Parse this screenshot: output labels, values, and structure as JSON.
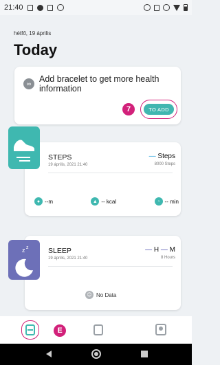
{
  "status_bar": {
    "time": "21:40"
  },
  "header": {
    "date": "hétfő, 19 április",
    "title": "Today"
  },
  "bracelet_card": {
    "message": "Add bracelet to get more health information",
    "button_label": "TO ADD",
    "callout": "7"
  },
  "steps_card": {
    "title": "STEPS",
    "timestamp": "19 április, 2021 21:40",
    "value_dash": "—",
    "value_unit": "Steps",
    "goal": "8000 Steps",
    "metrics": [
      {
        "icon": "location-icon",
        "label": "--m"
      },
      {
        "icon": "flame-icon",
        "label": "-- kcal"
      },
      {
        "icon": "clock-icon",
        "label": "-- min"
      }
    ]
  },
  "sleep_card": {
    "title": "SLEEP",
    "timestamp": "19 április, 2021 21:40",
    "hours_dash": "—",
    "hours_unit": "H",
    "min_dash": "—",
    "min_unit": "M",
    "goal": "8 Hours",
    "empty_text": "No Data"
  },
  "bottom_nav": {
    "callout": "E"
  },
  "colors": {
    "accent_teal": "#3fb8b0",
    "annotation_magenta": "#d2217a",
    "sleep_purple": "#6d70b8",
    "step_blue": "#29a3dd"
  }
}
